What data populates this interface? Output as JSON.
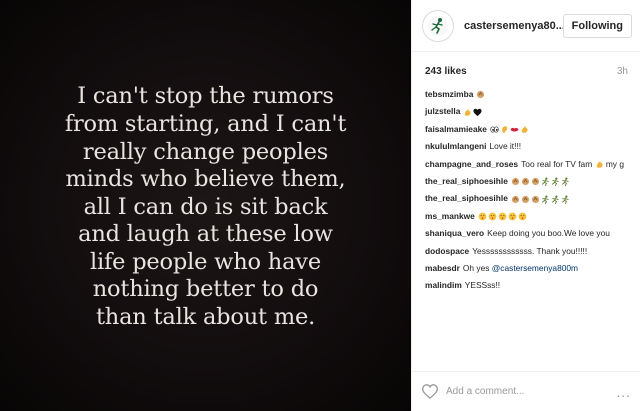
{
  "post": {
    "image_text": "I can't stop the rumors\nfrom starting, and I can't\nreally change peoples\nminds who believe them,\nall I can do is sit back\nand laugh at these low\nlife people who have\nnothing better to do\nthan talk about me.",
    "header": {
      "username": "castersemenya80...",
      "follow_label": "Following"
    },
    "likes": "243 likes",
    "time": "3h",
    "comments": [
      {
        "user": "tebsmzimba",
        "text": "",
        "emoji": [
          "clap-icon"
        ]
      },
      {
        "user": "julzstella",
        "text": "",
        "emoji": [
          "flexed-biceps-icon",
          "black-heart-icon"
        ]
      },
      {
        "user": "faisalmamieake",
        "text": "",
        "emoji": [
          "eyes-icon",
          "ear-icon",
          "lips-icon",
          "flexed-biceps-icon"
        ]
      },
      {
        "user": "nkululmlangeni",
        "text": "Love it!!!",
        "emoji": []
      },
      {
        "user": "champagne_and_roses",
        "text": "Too real for TV fam",
        "emoji": [
          "flexed-biceps-icon"
        ],
        "text_after": "my g"
      },
      {
        "user": "the_real_siphoesihle",
        "text": "",
        "emoji": [
          "clap-icon",
          "clap-icon",
          "clap-icon",
          "runner-icon",
          "runner-icon",
          "runner-icon"
        ]
      },
      {
        "user": "the_real_siphoesihle",
        "text": "",
        "emoji": [
          "clap-icon",
          "clap-icon",
          "clap-icon",
          "runner-icon",
          "runner-icon",
          "runner-icon"
        ]
      },
      {
        "user": "ms_mankwe",
        "text": "",
        "emoji": [
          "kiss-face-icon",
          "kiss-face-icon",
          "kiss-face-icon",
          "kiss-face-icon",
          "kiss-face-icon"
        ]
      },
      {
        "user": "shaniqua_vero",
        "text": "Keep doing you boo.We love you",
        "emoji": []
      },
      {
        "user": "dodospace",
        "text": "Yessssssssssss. Thank you!!!!!",
        "emoji": []
      },
      {
        "user": "mabesdr",
        "text": "Oh yes",
        "mention": "@castersemenya800m",
        "emoji": []
      },
      {
        "user": "malindim",
        "text": "YESSss!!",
        "emoji": []
      }
    ],
    "footer": {
      "add_comment_placeholder": "Add a comment...",
      "more_label": "..."
    },
    "colors": {
      "photo_bg": "#120d0e",
      "quote_text": "#e9e4e2",
      "username": "#262626",
      "meta_grey": "#999999",
      "mention": "#003569"
    }
  }
}
